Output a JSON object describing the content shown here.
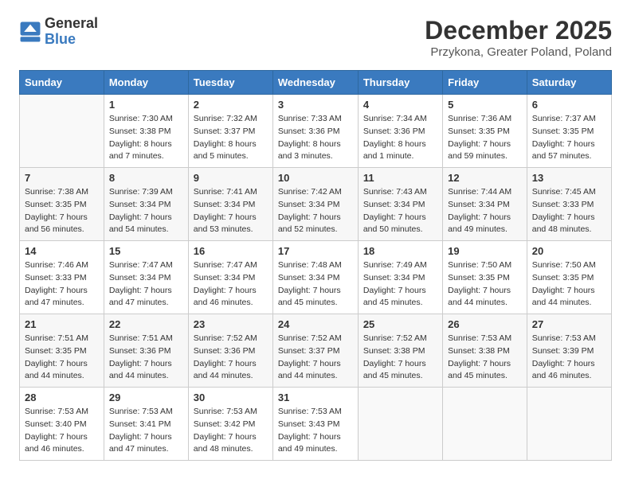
{
  "logo": {
    "general": "General",
    "blue": "Blue"
  },
  "title": {
    "month": "December 2025",
    "location": "Przykona, Greater Poland, Poland"
  },
  "weekdays": [
    "Sunday",
    "Monday",
    "Tuesday",
    "Wednesday",
    "Thursday",
    "Friday",
    "Saturday"
  ],
  "weeks": [
    [
      {
        "day": "",
        "info": ""
      },
      {
        "day": "1",
        "info": "Sunrise: 7:30 AM\nSunset: 3:38 PM\nDaylight: 8 hours\nand 7 minutes."
      },
      {
        "day": "2",
        "info": "Sunrise: 7:32 AM\nSunset: 3:37 PM\nDaylight: 8 hours\nand 5 minutes."
      },
      {
        "day": "3",
        "info": "Sunrise: 7:33 AM\nSunset: 3:36 PM\nDaylight: 8 hours\nand 3 minutes."
      },
      {
        "day": "4",
        "info": "Sunrise: 7:34 AM\nSunset: 3:36 PM\nDaylight: 8 hours\nand 1 minute."
      },
      {
        "day": "5",
        "info": "Sunrise: 7:36 AM\nSunset: 3:35 PM\nDaylight: 7 hours\nand 59 minutes."
      },
      {
        "day": "6",
        "info": "Sunrise: 7:37 AM\nSunset: 3:35 PM\nDaylight: 7 hours\nand 57 minutes."
      }
    ],
    [
      {
        "day": "7",
        "info": "Sunrise: 7:38 AM\nSunset: 3:35 PM\nDaylight: 7 hours\nand 56 minutes."
      },
      {
        "day": "8",
        "info": "Sunrise: 7:39 AM\nSunset: 3:34 PM\nDaylight: 7 hours\nand 54 minutes."
      },
      {
        "day": "9",
        "info": "Sunrise: 7:41 AM\nSunset: 3:34 PM\nDaylight: 7 hours\nand 53 minutes."
      },
      {
        "day": "10",
        "info": "Sunrise: 7:42 AM\nSunset: 3:34 PM\nDaylight: 7 hours\nand 52 minutes."
      },
      {
        "day": "11",
        "info": "Sunrise: 7:43 AM\nSunset: 3:34 PM\nDaylight: 7 hours\nand 50 minutes."
      },
      {
        "day": "12",
        "info": "Sunrise: 7:44 AM\nSunset: 3:34 PM\nDaylight: 7 hours\nand 49 minutes."
      },
      {
        "day": "13",
        "info": "Sunrise: 7:45 AM\nSunset: 3:33 PM\nDaylight: 7 hours\nand 48 minutes."
      }
    ],
    [
      {
        "day": "14",
        "info": "Sunrise: 7:46 AM\nSunset: 3:33 PM\nDaylight: 7 hours\nand 47 minutes."
      },
      {
        "day": "15",
        "info": "Sunrise: 7:47 AM\nSunset: 3:34 PM\nDaylight: 7 hours\nand 47 minutes."
      },
      {
        "day": "16",
        "info": "Sunrise: 7:47 AM\nSunset: 3:34 PM\nDaylight: 7 hours\nand 46 minutes."
      },
      {
        "day": "17",
        "info": "Sunrise: 7:48 AM\nSunset: 3:34 PM\nDaylight: 7 hours\nand 45 minutes."
      },
      {
        "day": "18",
        "info": "Sunrise: 7:49 AM\nSunset: 3:34 PM\nDaylight: 7 hours\nand 45 minutes."
      },
      {
        "day": "19",
        "info": "Sunrise: 7:50 AM\nSunset: 3:35 PM\nDaylight: 7 hours\nand 44 minutes."
      },
      {
        "day": "20",
        "info": "Sunrise: 7:50 AM\nSunset: 3:35 PM\nDaylight: 7 hours\nand 44 minutes."
      }
    ],
    [
      {
        "day": "21",
        "info": "Sunrise: 7:51 AM\nSunset: 3:35 PM\nDaylight: 7 hours\nand 44 minutes."
      },
      {
        "day": "22",
        "info": "Sunrise: 7:51 AM\nSunset: 3:36 PM\nDaylight: 7 hours\nand 44 minutes."
      },
      {
        "day": "23",
        "info": "Sunrise: 7:52 AM\nSunset: 3:36 PM\nDaylight: 7 hours\nand 44 minutes."
      },
      {
        "day": "24",
        "info": "Sunrise: 7:52 AM\nSunset: 3:37 PM\nDaylight: 7 hours\nand 44 minutes."
      },
      {
        "day": "25",
        "info": "Sunrise: 7:52 AM\nSunset: 3:38 PM\nDaylight: 7 hours\nand 45 minutes."
      },
      {
        "day": "26",
        "info": "Sunrise: 7:53 AM\nSunset: 3:38 PM\nDaylight: 7 hours\nand 45 minutes."
      },
      {
        "day": "27",
        "info": "Sunrise: 7:53 AM\nSunset: 3:39 PM\nDaylight: 7 hours\nand 46 minutes."
      }
    ],
    [
      {
        "day": "28",
        "info": "Sunrise: 7:53 AM\nSunset: 3:40 PM\nDaylight: 7 hours\nand 46 minutes."
      },
      {
        "day": "29",
        "info": "Sunrise: 7:53 AM\nSunset: 3:41 PM\nDaylight: 7 hours\nand 47 minutes."
      },
      {
        "day": "30",
        "info": "Sunrise: 7:53 AM\nSunset: 3:42 PM\nDaylight: 7 hours\nand 48 minutes."
      },
      {
        "day": "31",
        "info": "Sunrise: 7:53 AM\nSunset: 3:43 PM\nDaylight: 7 hours\nand 49 minutes."
      },
      {
        "day": "",
        "info": ""
      },
      {
        "day": "",
        "info": ""
      },
      {
        "day": "",
        "info": ""
      }
    ]
  ]
}
